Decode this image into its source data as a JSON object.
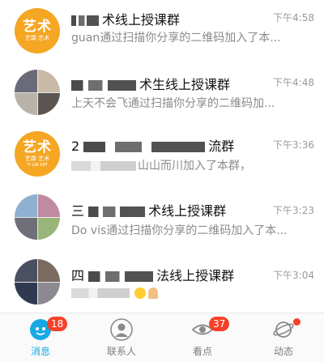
{
  "chats": [
    {
      "title_visible": "术线上授课群",
      "time": "下午4:58",
      "preview": "guan通过扫描你分享的二维码加入了本..."
    },
    {
      "title_visible": "术生线上授课群",
      "time": "下午4:48",
      "preview": "上天不会飞通过扫描你分享的二维码加..."
    },
    {
      "title_prefix": "2",
      "title_visible": "流群",
      "time": "下午3:36",
      "preview": "山山而川加入了本群，"
    },
    {
      "title_prefix": "三",
      "title_visible": "术线上授课群",
      "time": "下午3:23",
      "preview": "Do vis通过扫描你分享的二维码加入了本..."
    },
    {
      "title_prefix": "四",
      "title_visible": "法线上授课群",
      "time": "下午3:04",
      "preview": ""
    }
  ],
  "avatar_yellow": {
    "logo": "艺术",
    "line1": "艺霖·艺术",
    "line2": "YI LIN ART"
  },
  "tabbar": {
    "messages": {
      "label": "消息",
      "badge": "18"
    },
    "contacts": {
      "label": "联系人"
    },
    "watch": {
      "label": "看点",
      "badge": "37"
    },
    "feed": {
      "label": "动态"
    }
  },
  "colors": {
    "accent": "#17a8e6",
    "badge": "#f5412a",
    "brand_yellow": "#f5a623"
  }
}
